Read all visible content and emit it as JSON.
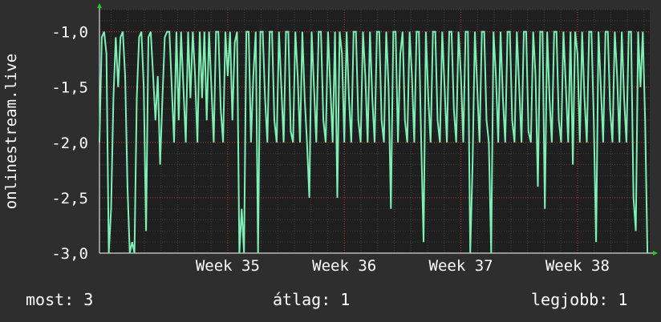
{
  "chart_data": {
    "type": "line",
    "ylabel": "onlinestream.live",
    "ylim": [
      -3.0,
      -0.8
    ],
    "yticks": [
      -1.0,
      -1.5,
      -2.0,
      -2.5,
      -3.0
    ],
    "ytick_labels": [
      "-1,0",
      "-1,5",
      "-2,0",
      "-2,5",
      "-3,0"
    ],
    "xlim": [
      33.9,
      38.62
    ],
    "xticks": [
      35,
      36,
      37,
      38
    ],
    "xtick_labels": [
      "Week 35",
      "Week 36",
      "Week 37",
      "Week 38"
    ],
    "grid": true,
    "colors": {
      "background": "#2e2e2e",
      "plot": "#1f1f1f",
      "line": "#7ef0b6",
      "grid": "#c0392b",
      "axis_arrow": "#22cc22"
    },
    "series": [
      {
        "values": [
          [
            33.9,
            -2.0
          ],
          [
            33.92,
            -1.05
          ],
          [
            33.94,
            -1.0
          ],
          [
            33.96,
            -1.2
          ],
          [
            33.98,
            -3.0
          ],
          [
            34.0,
            -2.6
          ],
          [
            34.02,
            -1.6
          ],
          [
            34.04,
            -1.05
          ],
          [
            34.06,
            -1.5
          ],
          [
            34.08,
            -1.05
          ],
          [
            34.1,
            -1.0
          ],
          [
            34.12,
            -1.4
          ],
          [
            34.14,
            -2.4
          ],
          [
            34.16,
            -3.0
          ],
          [
            34.18,
            -2.9
          ],
          [
            34.2,
            -3.0
          ],
          [
            34.22,
            -1.6
          ],
          [
            34.24,
            -1.05
          ],
          [
            34.26,
            -1.0
          ],
          [
            34.28,
            -1.5
          ],
          [
            34.3,
            -2.8
          ],
          [
            34.32,
            -1.05
          ],
          [
            34.34,
            -1.0
          ],
          [
            34.36,
            -1.4
          ],
          [
            34.38,
            -1.8
          ],
          [
            34.4,
            -1.4
          ],
          [
            34.42,
            -2.2
          ],
          [
            34.44,
            -1.6
          ],
          [
            34.46,
            -1.05
          ],
          [
            34.48,
            -1.0
          ],
          [
            34.5,
            -1.0
          ],
          [
            34.52,
            -1.5
          ],
          [
            34.54,
            -2.0
          ],
          [
            34.56,
            -1.0
          ],
          [
            34.58,
            -1.8
          ],
          [
            34.6,
            -1.0
          ],
          [
            34.62,
            -1.5
          ],
          [
            34.64,
            -2.0
          ],
          [
            34.66,
            -1.0
          ],
          [
            34.68,
            -1.6
          ],
          [
            34.7,
            -1.0
          ],
          [
            34.72,
            -1.4
          ],
          [
            34.74,
            -2.0
          ],
          [
            34.76,
            -1.0
          ],
          [
            34.78,
            -1.6
          ],
          [
            34.8,
            -1.0
          ],
          [
            34.82,
            -1.8
          ],
          [
            34.84,
            -1.0
          ],
          [
            34.86,
            -1.5
          ],
          [
            34.88,
            -2.0
          ],
          [
            34.9,
            -1.0
          ],
          [
            34.92,
            -1.0
          ],
          [
            34.94,
            -1.7
          ],
          [
            34.96,
            -2.0
          ],
          [
            34.98,
            -1.0
          ],
          [
            35.0,
            -1.4
          ],
          [
            35.02,
            -1.0
          ],
          [
            35.04,
            -1.8
          ],
          [
            35.06,
            -1.1
          ],
          [
            35.08,
            -1.0
          ],
          [
            35.1,
            -3.0
          ],
          [
            35.12,
            -2.6
          ],
          [
            35.14,
            -3.0
          ],
          [
            35.16,
            -1.0
          ],
          [
            35.18,
            -1.0
          ],
          [
            35.2,
            -2.0
          ],
          [
            35.22,
            -1.4
          ],
          [
            35.24,
            -1.0
          ],
          [
            35.26,
            -3.0
          ],
          [
            35.28,
            -1.0
          ],
          [
            35.3,
            -1.0
          ],
          [
            35.32,
            -1.6
          ],
          [
            35.34,
            -2.0
          ],
          [
            35.36,
            -1.0
          ],
          [
            35.38,
            -1.0
          ],
          [
            35.4,
            -1.8
          ],
          [
            35.42,
            -2.0
          ],
          [
            35.44,
            -1.0
          ],
          [
            35.46,
            -1.5
          ],
          [
            35.48,
            -2.0
          ],
          [
            35.5,
            -1.0
          ],
          [
            35.52,
            -1.0
          ],
          [
            35.54,
            -1.9
          ],
          [
            35.56,
            -2.0
          ],
          [
            35.58,
            -1.0
          ],
          [
            35.6,
            -1.4
          ],
          [
            35.62,
            -2.0
          ],
          [
            35.64,
            -1.0
          ],
          [
            35.66,
            -1.6
          ],
          [
            35.68,
            -2.0
          ],
          [
            35.7,
            -2.5
          ],
          [
            35.72,
            -1.0
          ],
          [
            35.74,
            -1.5
          ],
          [
            35.76,
            -2.0
          ],
          [
            35.78,
            -1.0
          ],
          [
            35.8,
            -1.0
          ],
          [
            35.82,
            -1.8
          ],
          [
            35.84,
            -2.0
          ],
          [
            35.86,
            -1.0
          ],
          [
            35.88,
            -1.5
          ],
          [
            35.9,
            -2.0
          ],
          [
            35.92,
            -1.0
          ],
          [
            35.94,
            -2.5
          ],
          [
            35.96,
            -1.0
          ],
          [
            35.98,
            -1.2
          ],
          [
            36.0,
            -2.0
          ],
          [
            36.02,
            -1.0
          ],
          [
            36.04,
            -1.6
          ],
          [
            36.06,
            -2.0
          ],
          [
            36.08,
            -1.0
          ],
          [
            36.1,
            -1.0
          ],
          [
            36.12,
            -1.8
          ],
          [
            36.14,
            -2.0
          ],
          [
            36.16,
            -1.0
          ],
          [
            36.18,
            -1.4
          ],
          [
            36.2,
            -2.0
          ],
          [
            36.22,
            -1.0
          ],
          [
            36.24,
            -1.6
          ],
          [
            36.26,
            -2.0
          ],
          [
            36.28,
            -1.0
          ],
          [
            36.3,
            -1.0
          ],
          [
            36.32,
            -1.8
          ],
          [
            36.34,
            -2.0
          ],
          [
            36.36,
            -1.0
          ],
          [
            36.38,
            -1.5
          ],
          [
            36.4,
            -2.6
          ],
          [
            36.42,
            -1.0
          ],
          [
            36.44,
            -1.0
          ],
          [
            36.46,
            -2.0
          ],
          [
            36.48,
            -1.2
          ],
          [
            36.5,
            -1.0
          ],
          [
            36.52,
            -1.8
          ],
          [
            36.54,
            -2.0
          ],
          [
            36.56,
            -1.0
          ],
          [
            36.58,
            -1.4
          ],
          [
            36.6,
            -2.0
          ],
          [
            36.62,
            -1.0
          ],
          [
            36.64,
            -1.0
          ],
          [
            36.66,
            -2.0
          ],
          [
            36.68,
            -2.9
          ],
          [
            36.7,
            -1.0
          ],
          [
            36.72,
            -1.6
          ],
          [
            36.74,
            -2.0
          ],
          [
            36.76,
            -1.0
          ],
          [
            36.78,
            -1.0
          ],
          [
            36.8,
            -1.8
          ],
          [
            36.82,
            -2.0
          ],
          [
            36.84,
            -1.0
          ],
          [
            36.86,
            -1.5
          ],
          [
            36.88,
            -2.0
          ],
          [
            36.9,
            -1.0
          ],
          [
            36.92,
            -1.0
          ],
          [
            36.94,
            -1.7
          ],
          [
            36.96,
            -2.0
          ],
          [
            36.98,
            -1.0
          ],
          [
            37.0,
            -1.4
          ],
          [
            37.02,
            -2.0
          ],
          [
            37.04,
            -1.0
          ],
          [
            37.06,
            -1.0
          ],
          [
            37.08,
            -3.0
          ],
          [
            37.1,
            -2.2
          ],
          [
            37.12,
            -1.0
          ],
          [
            37.14,
            -1.5
          ],
          [
            37.16,
            -2.0
          ],
          [
            37.18,
            -1.0
          ],
          [
            37.2,
            -1.0
          ],
          [
            37.22,
            -1.8
          ],
          [
            37.24,
            -2.0
          ],
          [
            37.26,
            -3.0
          ],
          [
            37.28,
            -1.0
          ],
          [
            37.3,
            -1.4
          ],
          [
            37.32,
            -2.0
          ],
          [
            37.34,
            -1.0
          ],
          [
            37.36,
            -1.6
          ],
          [
            37.38,
            -2.0
          ],
          [
            37.4,
            -1.0
          ],
          [
            37.42,
            -1.0
          ],
          [
            37.44,
            -1.8
          ],
          [
            37.46,
            -2.0
          ],
          [
            37.48,
            -1.0
          ],
          [
            37.5,
            -1.5
          ],
          [
            37.52,
            -2.0
          ],
          [
            37.54,
            -1.0
          ],
          [
            37.56,
            -1.0
          ],
          [
            37.58,
            -1.9
          ],
          [
            37.6,
            -2.0
          ],
          [
            37.62,
            -1.0
          ],
          [
            37.64,
            -1.4
          ],
          [
            37.66,
            -2.4
          ],
          [
            37.68,
            -1.0
          ],
          [
            37.7,
            -1.0
          ],
          [
            37.72,
            -2.6
          ],
          [
            37.74,
            -1.0
          ],
          [
            37.76,
            -1.6
          ],
          [
            37.78,
            -2.0
          ],
          [
            37.8,
            -1.0
          ],
          [
            37.82,
            -1.0
          ],
          [
            37.84,
            -1.8
          ],
          [
            37.86,
            -2.0
          ],
          [
            37.88,
            -1.0
          ],
          [
            37.9,
            -1.5
          ],
          [
            37.92,
            -2.0
          ],
          [
            37.94,
            -1.0
          ],
          [
            37.96,
            -2.2
          ],
          [
            37.98,
            -1.0
          ],
          [
            38.0,
            -1.2
          ],
          [
            38.02,
            -2.0
          ],
          [
            38.04,
            -1.0
          ],
          [
            38.06,
            -1.6
          ],
          [
            38.08,
            -2.0
          ],
          [
            38.1,
            -1.0
          ],
          [
            38.12,
            -1.0
          ],
          [
            38.14,
            -1.8
          ],
          [
            38.16,
            -2.9
          ],
          [
            38.18,
            -1.0
          ],
          [
            38.2,
            -1.5
          ],
          [
            38.22,
            -2.0
          ],
          [
            38.24,
            -1.0
          ],
          [
            38.26,
            -1.0
          ],
          [
            38.28,
            -1.7
          ],
          [
            38.3,
            -2.0
          ],
          [
            38.32,
            -1.0
          ],
          [
            38.34,
            -1.4
          ],
          [
            38.36,
            -2.0
          ],
          [
            38.38,
            -1.0
          ],
          [
            38.4,
            -1.6
          ],
          [
            38.42,
            -2.0
          ],
          [
            38.44,
            -1.0
          ],
          [
            38.46,
            -1.0
          ],
          [
            38.48,
            -2.5
          ],
          [
            38.5,
            -2.8
          ],
          [
            38.52,
            -1.0
          ],
          [
            38.54,
            -1.5
          ],
          [
            38.56,
            -1.0
          ],
          [
            38.58,
            -1.8
          ],
          [
            38.6,
            -3.0
          ]
        ]
      }
    ]
  },
  "footer": {
    "most_label": "most:",
    "most_value": "3",
    "atlag_label": "átlag:",
    "atlag_value": "1",
    "legjobb_label": "legjobb:",
    "legjobb_value": "1"
  }
}
